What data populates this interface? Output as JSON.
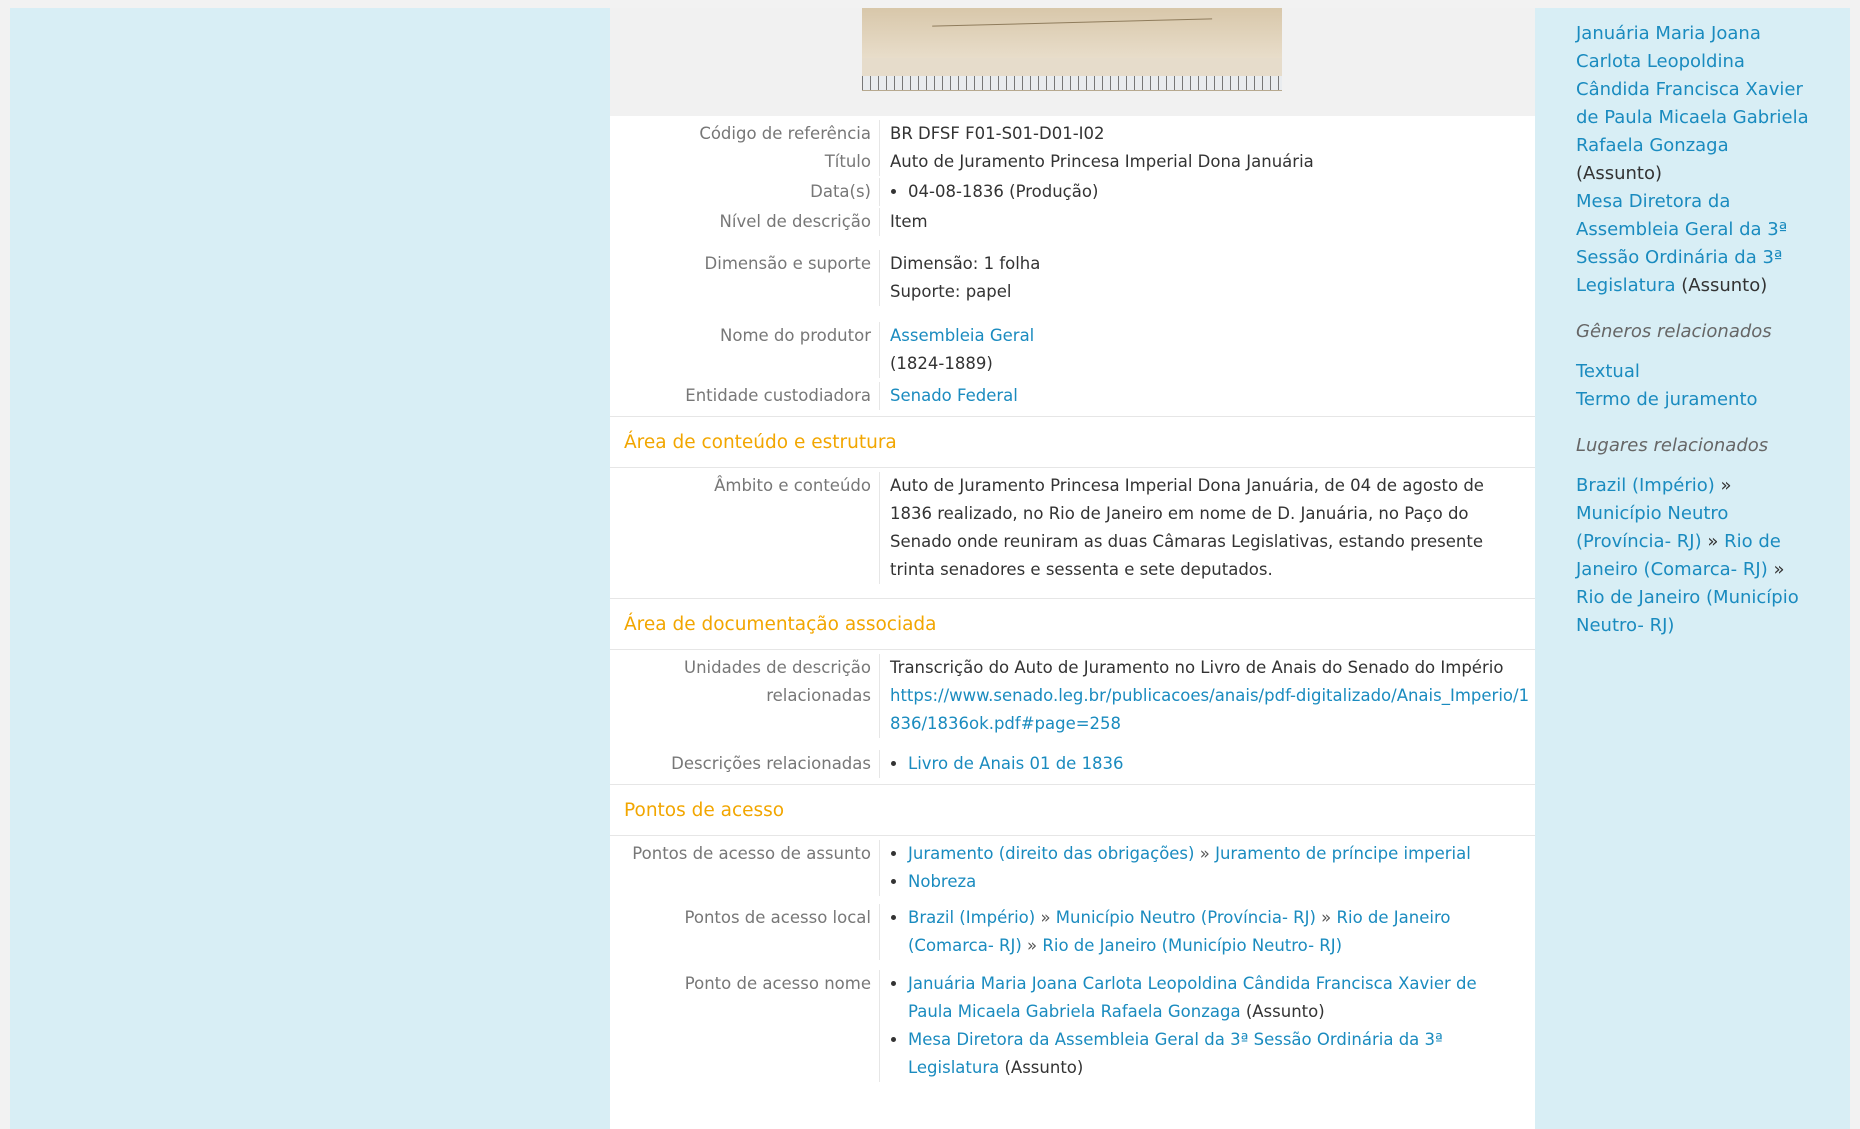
{
  "details": {
    "ref_label": "Código de referência",
    "ref_value": "BR DFSF F01-S01-D01-I02",
    "title_label": "Título",
    "title_value": "Auto de Juramento Princesa Imperial Dona Januária",
    "dates_label": "Data(s)",
    "dates_item": "04-08-1836 (Produção)",
    "level_label": "Nível de descrição",
    "level_value": "Item",
    "dimension_label": "Dimensão e suporte",
    "dimension_line1": "Dimensão: 1 folha",
    "dimension_line2": "Suporte: papel",
    "producer_label": "Nome do produtor",
    "producer_link": "Assembleia Geral",
    "producer_years": "(1824-1889)",
    "custodian_label": "Entidade custodiadora",
    "custodian_link": "Senado Federal"
  },
  "sections": {
    "content": "Área de conteúdo e estrutura",
    "documentation": "Área de documentação associada",
    "access": "Pontos de acesso"
  },
  "content": {
    "scope_label": "Âmbito e conteúdo",
    "scope_text": "Auto de Juramento Princesa Imperial Dona Januária, de 04 de agosto de 1836 realizado, no Rio de Janeiro em nome de D. Januária, no Paço do Senado onde reuniram as duas Câmaras Legislativas, estando presente trinta senadores e sessenta e sete deputados."
  },
  "documentation": {
    "units_label_1": "Unidades de descrição",
    "units_label_2": "relacionadas",
    "units_text": "Transcrição do Auto de Juramento no Livro de Anais do Senado do Império",
    "units_link": "https://www.senado.leg.br/publicacoes/anais/pdf-digitalizado/Anais_Imperio/1836/1836ok.pdf#page=258",
    "related_label": "Descrições relacionadas",
    "related_item": "Livro de Anais 01 de 1836"
  },
  "access": {
    "subject_label": "Pontos de acesso de assunto",
    "subject_item1_a": "Juramento (direito das obrigações)",
    "subject_item1_sep": " » ",
    "subject_item1_b": "Juramento de príncipe imperial",
    "subject_item2": "Nobreza",
    "place_label": "Pontos de acesso local",
    "place_a": "Brazil (Império)",
    "place_sep1": " » ",
    "place_b": "Município Neutro (Província- RJ)",
    "place_sep2": " » ",
    "place_c": "Rio de Janeiro (Comarca- RJ)",
    "place_sep3": " » ",
    "place_d": "Rio de Janeiro (Município Neutro- RJ)",
    "name_label": "Ponto de acesso nome",
    "name_item1": "Januária Maria Joana Carlota Leopoldina Cândida Francisca Xavier de Paula Micaela Gabriela Rafaela Gonzaga",
    "name_item1_suffix": "(Assunto)",
    "name_item2": "Mesa Diretora da Assembleia Geral da 3ª Sessão Ordinária da 3ª Legislatura",
    "name_item2_suffix": "(Assunto)"
  },
  "sidebar": {
    "person_link": "Januária Maria Joana Carlota Leopoldina Cândida Francisca Xavier de Paula Micaela Gabriela Rafaela Gonzaga",
    "person_suffix": "(Assunto)",
    "mesa_link": "Mesa Diretora da Assembleia Geral da 3ª Sessão Ordinária da 3ª Legislatura",
    "mesa_suffix": "(Assunto)",
    "genres_heading": "Gêneros relacionados",
    "genre1": "Textual",
    "genre2": "Termo de juramento",
    "places_heading": "Lugares relacionados",
    "place_a": "Brazil (Império)",
    "sep": " » ",
    "place_b": "Município Neutro (Província- RJ)",
    "place_c": "Rio de Janeiro (Comarca- RJ)",
    "place_d": "Rio de Janeiro (Município Neutro- RJ)"
  }
}
